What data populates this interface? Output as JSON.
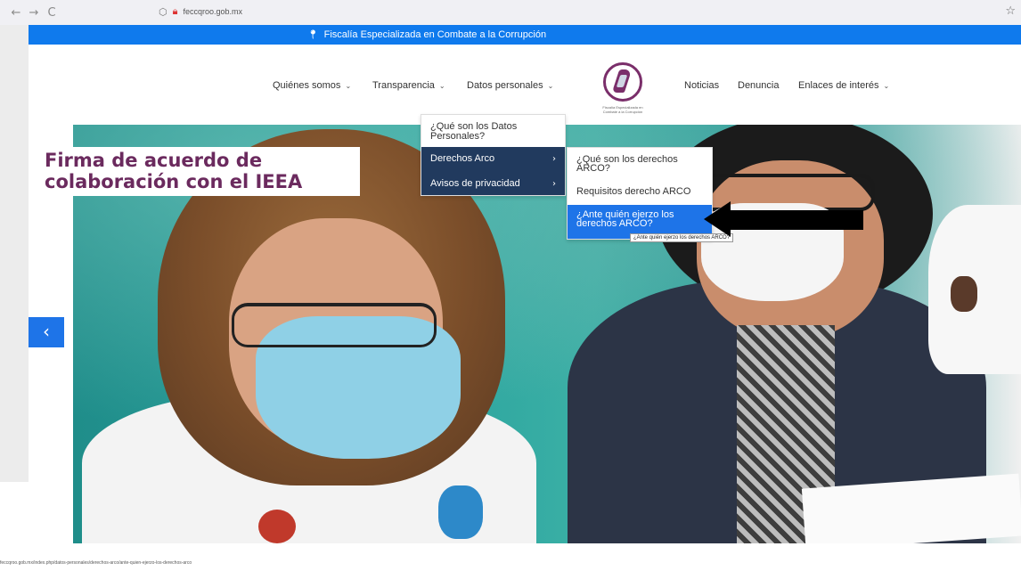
{
  "browser": {
    "back_icon": "←",
    "forward_icon": "→",
    "reload_icon": "C",
    "shield_icon": "shield-icon",
    "url": "feccqroo.gob.mx",
    "star_icon": "☆"
  },
  "top_bar": {
    "text": "Fiscalía Especializada en Combate a la Corrupción",
    "color": "#0f7aed"
  },
  "nav": {
    "items": [
      {
        "label": "Quiénes somos"
      },
      {
        "label": "Transparencia"
      },
      {
        "label": "Datos personales"
      },
      {
        "label": "Noticias"
      },
      {
        "label": "Denuncia"
      },
      {
        "label": "Enlaces de interés"
      }
    ],
    "logo_text": "Fiscalía Especializada en Combate a la Corrupción"
  },
  "hero": {
    "headline_line1": "Firma de acuerdo de",
    "headline_line2": "colaboración con el IEEA",
    "prev_icon": "‹"
  },
  "menu_datos": {
    "items": [
      {
        "label": "¿Qué son los Datos Personales?"
      },
      {
        "label": "Derechos Arco"
      },
      {
        "label": "Avisos de privacidad"
      }
    ]
  },
  "menu_arco": {
    "items": [
      {
        "label": "¿Qué son los derechos ARCO?"
      },
      {
        "label": "Requisitos derecho ARCO"
      },
      {
        "label": "¿Ante quién ejerzo los derechos ARCO?"
      }
    ]
  },
  "tooltip": "¿Ante quién ejerzo los derechos ARCO?",
  "status_url": "feccqroo.gob.mx/index.php/datos-personales/derechos-arco/ante-quien-ejerzo-los-derechos-arco",
  "accent_color": "#1e74e8",
  "brand_color": "#6b2a5e"
}
